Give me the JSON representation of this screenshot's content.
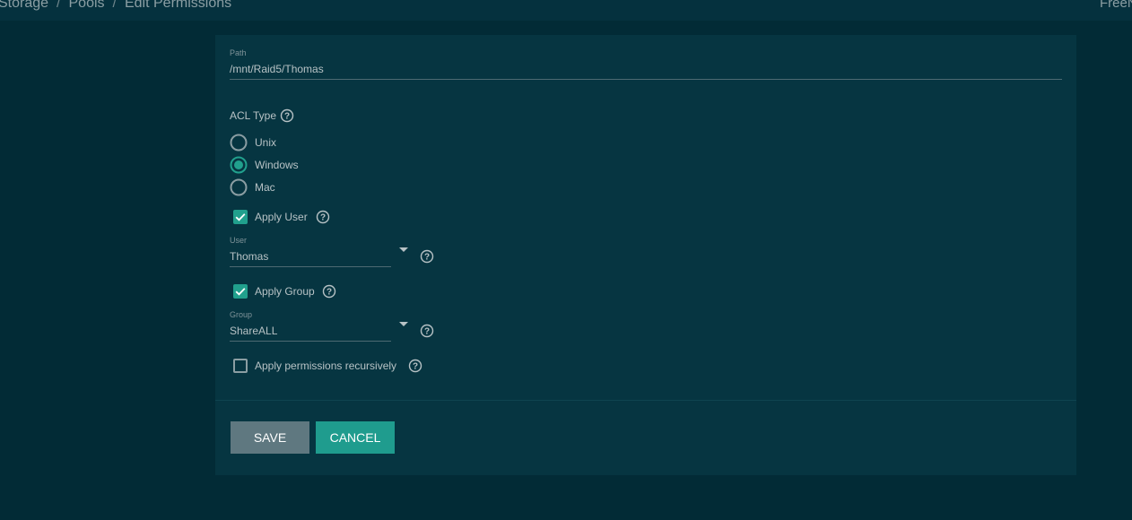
{
  "header": {
    "breadcrumb": [
      "Storage",
      "Pools",
      "Edit Permissions"
    ],
    "brand": "FreeN"
  },
  "form": {
    "path": {
      "label": "Path",
      "value": "/mnt/Raid5/Thomas"
    },
    "acl_type": {
      "label": "ACL Type",
      "options": [
        "Unix",
        "Windows",
        "Mac"
      ],
      "selected": "Windows"
    },
    "apply_user": {
      "label": "Apply User",
      "checked": true
    },
    "user": {
      "label": "User",
      "value": "Thomas"
    },
    "apply_group": {
      "label": "Apply Group",
      "checked": true
    },
    "group": {
      "label": "Group",
      "value": "ShareALL"
    },
    "recursive": {
      "label": "Apply permissions recursively",
      "checked": false
    }
  },
  "actions": {
    "save_label": "SAVE",
    "cancel_label": "CANCEL"
  },
  "colors": {
    "page_background": "#022b36",
    "card_background": "#063541",
    "accent": "#21a08d",
    "save_button": "#5f7880",
    "cancel_button": "#1f9c8e"
  },
  "icons": {
    "help": "help-circle-icon",
    "dropdown": "caret-down-icon",
    "check": "check-icon"
  }
}
